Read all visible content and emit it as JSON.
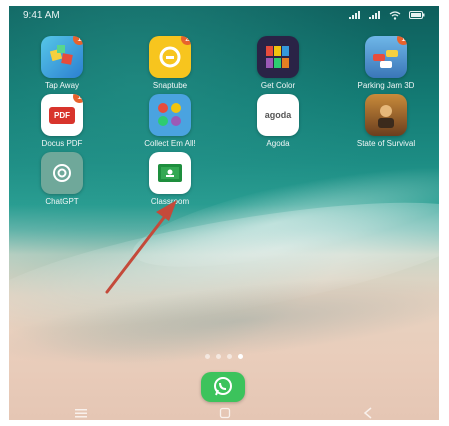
{
  "status_bar": {
    "time": "9:41 AM",
    "icons": [
      "whatsapp-icon",
      "mail-icon",
      "wifi-icon",
      "battery-icon"
    ]
  },
  "apps": [
    {
      "label": "Tap Away",
      "badge": "1"
    },
    {
      "label": "Snaptube",
      "badge": "2"
    },
    {
      "label": "Get Color",
      "badge": ""
    },
    {
      "label": "Parking Jam 3D",
      "badge": "1"
    },
    {
      "label": "Docus PDF",
      "badge": "1"
    },
    {
      "label": "Collect Em All!",
      "badge": ""
    },
    {
      "label": "Agoda",
      "badge": ""
    },
    {
      "label": "State of Survival",
      "badge": ""
    },
    {
      "label": "ChatGPT",
      "badge": ""
    },
    {
      "label": "Classroom",
      "badge": ""
    }
  ],
  "agoda_logo_text": "agoda",
  "pdf_logo_text": "PDF",
  "page_indicator": {
    "count": 4,
    "active": 3
  },
  "dock": {
    "app": "WhatsApp"
  },
  "colors": {
    "accent": "#e8622c",
    "whatsapp": "#3cc35c",
    "arrow": "#c44a3a"
  }
}
